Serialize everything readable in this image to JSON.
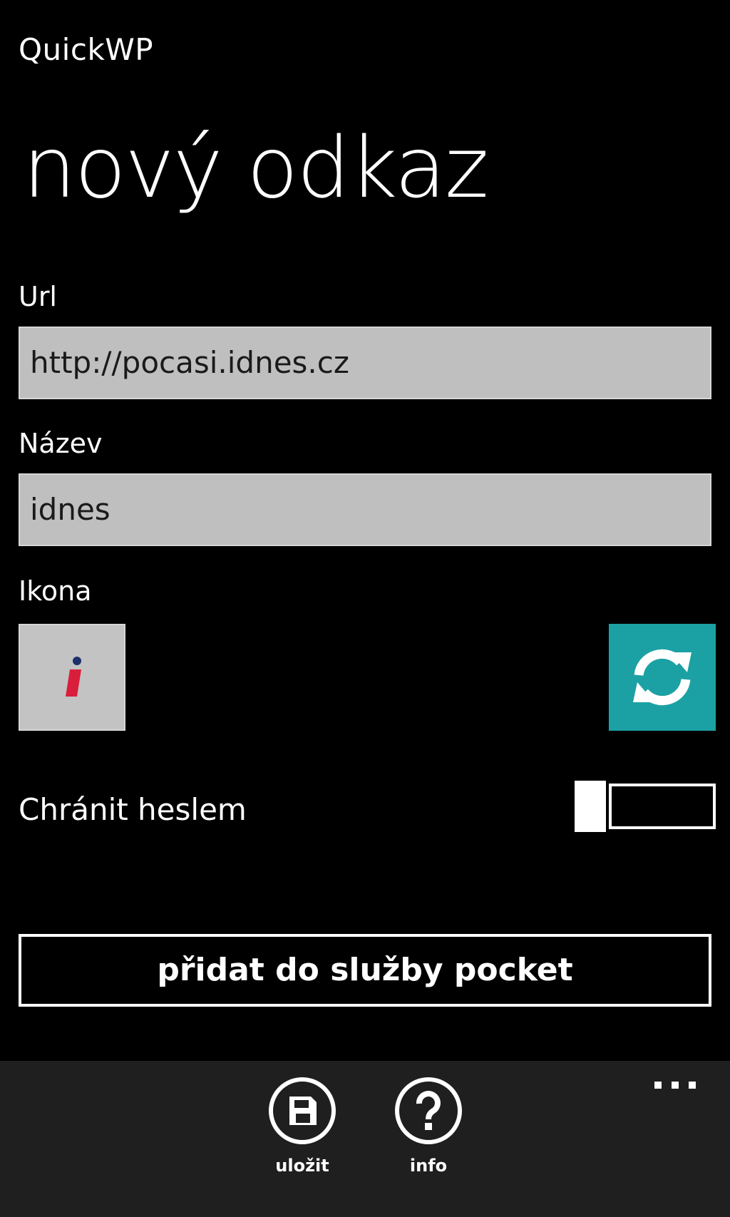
{
  "app": {
    "title": "QuickWP"
  },
  "page": {
    "title": "nový odkaz"
  },
  "form": {
    "url_label": "Url",
    "url_value": "http://pocasi.idnes.cz",
    "name_label": "Název",
    "name_value": "idnes",
    "icon_label": "Ikona",
    "icon_preview": "idnes-logo-icon",
    "refresh_icon": "refresh-icon",
    "accent_color": "#1ba1a3",
    "password_label": "Chránit heslem",
    "password_toggle_on": false,
    "pocket_button_label": "přidat do služby pocket"
  },
  "app_bar": {
    "save_label": "uložit",
    "save_icon": "save-icon",
    "info_label": "info",
    "info_icon": "help-icon",
    "more_icon": "ellipsis-icon"
  }
}
